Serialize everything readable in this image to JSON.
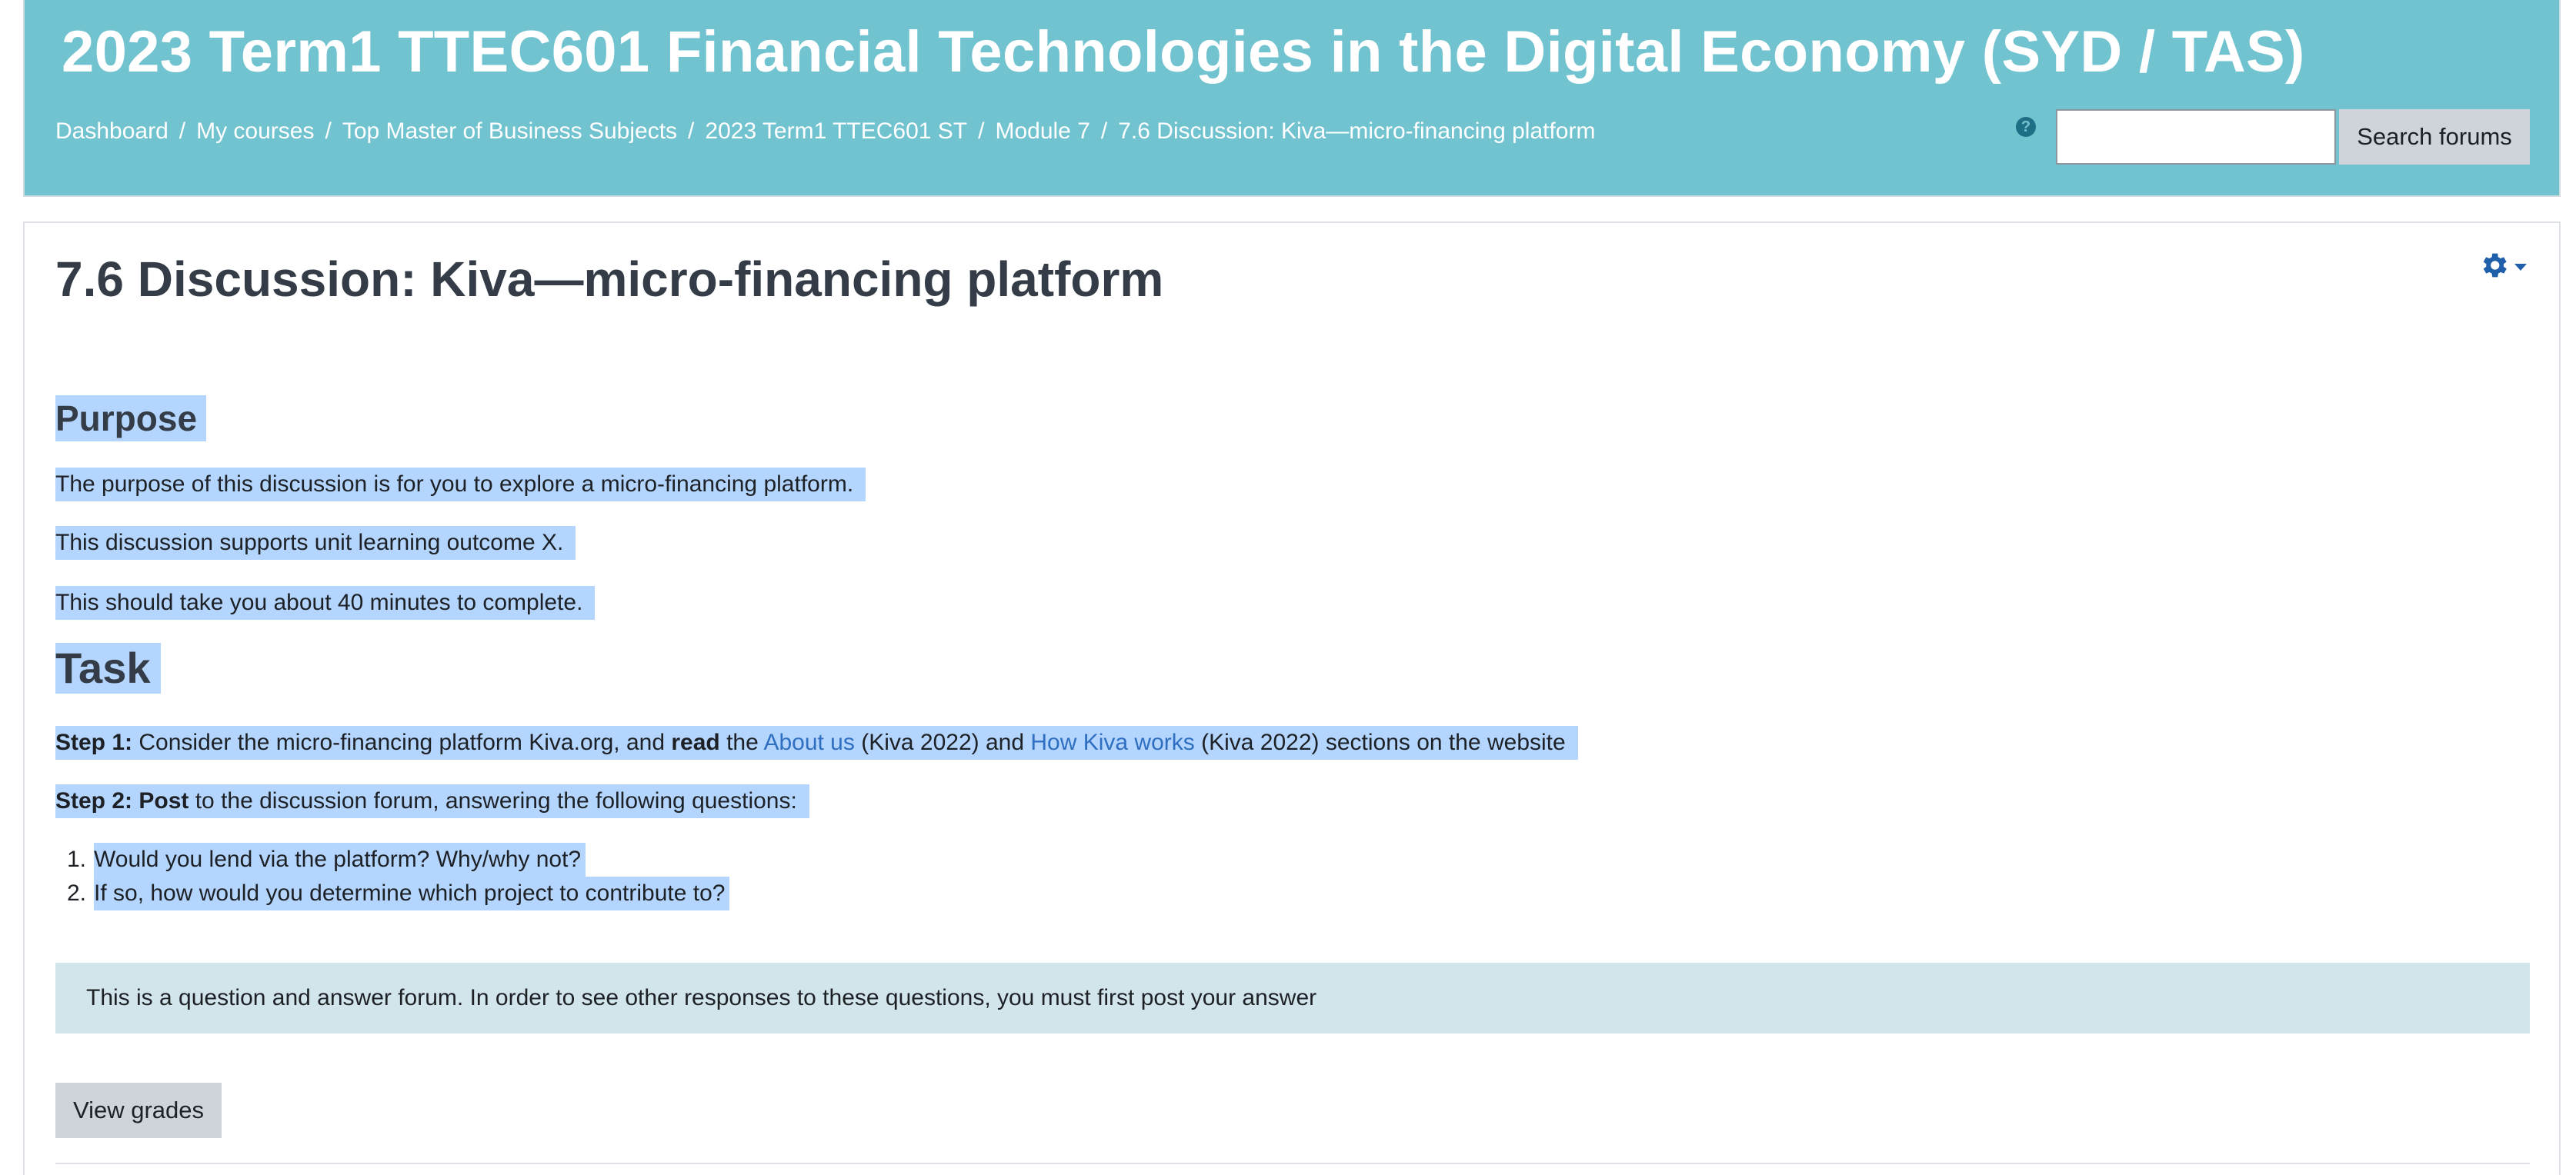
{
  "header": {
    "course_title": "2023 Term1 TTEC601 Financial Technologies in the Digital Economy (SYD / TAS)",
    "breadcrumb": [
      "Dashboard",
      "My courses",
      "Top Master of Business Subjects",
      "2023 Term1 TTEC601 ST",
      "Module 7",
      "7.6 Discussion: Kiva—micro-financing platform"
    ],
    "breadcrumb_separator": "/",
    "help_icon": "question-circle-icon",
    "search_placeholder": "",
    "search_button": "Search forums"
  },
  "page": {
    "title": "7.6 Discussion: Kiva—micro-financing platform",
    "settings_icon": "gear-icon"
  },
  "content": {
    "purpose_heading": "Purpose",
    "purpose_p1": "The purpose of this discussion is for you to explore a micro-financing platform.",
    "purpose_p2": "This discussion supports unit learning outcome X.",
    "purpose_p3": "This should take you about 40 minutes to complete.",
    "task_heading": "Task",
    "step1": {
      "label": "Step 1:",
      "text_a": " Consider the micro-financing platform Kiva.org, and ",
      "bold": "read",
      "text_b": " the ",
      "link1": "About us",
      "text_c": " (Kiva 2022) and ",
      "link2": "How Kiva works",
      "text_d": " (Kiva 2022) sections on the website"
    },
    "step2": {
      "label": "Step 2:",
      "bold": " Post",
      "text": " to the discussion forum, answering the following questions:"
    },
    "questions": [
      "Would you lend via the platform? Why/why not?",
      "If so, how would you determine which project to contribute to?"
    ]
  },
  "notice": "This is a question and answer forum. In order to see other responses to these questions, you must first post your answer",
  "actions": {
    "view_grades": "View grades"
  },
  "colors": {
    "header_bg": "#72c3d0",
    "selection": "#b4d5fe",
    "link": "#2f6fc1",
    "notice_bg": "#d2e5ea"
  }
}
